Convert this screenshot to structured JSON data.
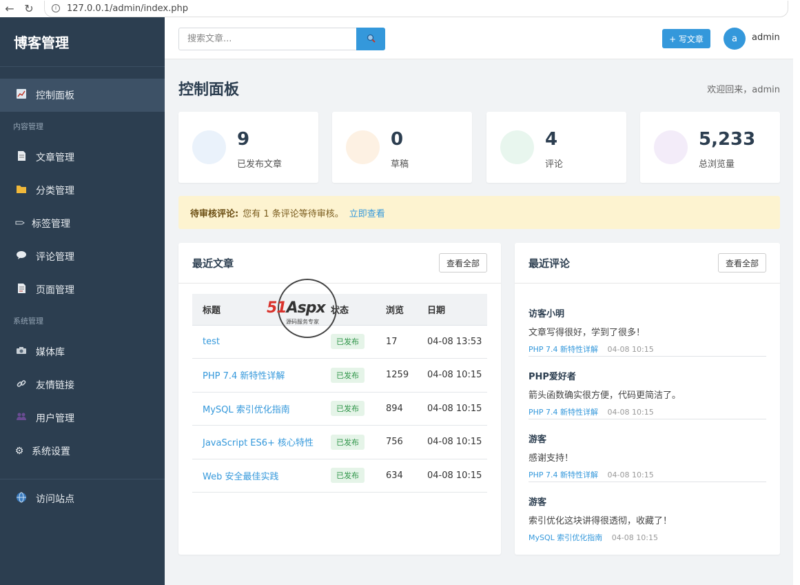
{
  "browser": {
    "url": "127.0.0.1/admin/index.php"
  },
  "sidebar": {
    "brand": "博客管理",
    "dashboard": {
      "label": "控制面板",
      "icon": "chart-icon"
    },
    "section_content": "内容管理",
    "content_items": [
      {
        "label": "文章管理",
        "icon": "document-icon"
      },
      {
        "label": "分类管理",
        "icon": "folder-icon"
      },
      {
        "label": "标签管理",
        "icon": "tag-icon"
      },
      {
        "label": "评论管理",
        "icon": "comment-icon"
      },
      {
        "label": "页面管理",
        "icon": "page-icon"
      }
    ],
    "section_system": "系统管理",
    "system_items": [
      {
        "label": "媒体库",
        "icon": "camera-icon"
      },
      {
        "label": "友情链接",
        "icon": "link-icon"
      },
      {
        "label": "用户管理",
        "icon": "users-icon"
      },
      {
        "label": "系统设置",
        "icon": "gear-icon"
      }
    ],
    "visit_site": {
      "label": "访问站点",
      "icon": "globe-icon"
    }
  },
  "header": {
    "search_placeholder": "搜索文章...",
    "write_button": "+ 写文章",
    "avatar_letter": "a",
    "username": "admin"
  },
  "page": {
    "title": "控制面板",
    "welcome": "欢迎回来，admin"
  },
  "stats": [
    {
      "value": "9",
      "label": "已发布文章",
      "color": "#eaf2fb"
    },
    {
      "value": "0",
      "label": "草稿",
      "color": "#fdf1e3"
    },
    {
      "value": "4",
      "label": "评论",
      "color": "#e8f6ee"
    },
    {
      "value": "5,233",
      "label": "总浏览量",
      "color": "#f3ecf9"
    }
  ],
  "alert": {
    "label": "待审核评论:",
    "message": "您有 1 条评论等待审核。",
    "link": "立即查看"
  },
  "recent_posts": {
    "title": "最近文章",
    "view_all": "查看全部",
    "columns": [
      "标题",
      "状态",
      "浏览",
      "日期"
    ],
    "rows": [
      {
        "title": "test",
        "status": "已发布",
        "views": "17",
        "date": "04-08 13:53"
      },
      {
        "title": "PHP 7.4 新特性详解",
        "status": "已发布",
        "views": "1259",
        "date": "04-08 10:15"
      },
      {
        "title": "MySQL 索引优化指南",
        "status": "已发布",
        "views": "894",
        "date": "04-08 10:15"
      },
      {
        "title": "JavaScript ES6+ 核心特性",
        "status": "已发布",
        "views": "756",
        "date": "04-08 10:15"
      },
      {
        "title": "Web 安全最佳实践",
        "status": "已发布",
        "views": "634",
        "date": "04-08 10:15"
      }
    ]
  },
  "recent_comments": {
    "title": "最近评论",
    "view_all": "查看全部",
    "items": [
      {
        "author": "访客小明",
        "text": "文章写得很好，学到了很多！",
        "post": "PHP 7.4 新特性详解",
        "time": "04-08 10:15"
      },
      {
        "author": "PHP爱好者",
        "text": "箭头函数确实很方便，代码更简洁了。",
        "post": "PHP 7.4 新特性详解",
        "time": "04-08 10:15"
      },
      {
        "author": "游客",
        "text": "感谢支持！",
        "post": "PHP 7.4 新特性详解",
        "time": "04-08 10:15"
      },
      {
        "author": "游客",
        "text": "索引优化这块讲得很透彻，收藏了！",
        "post": "MySQL 索引优化指南",
        "time": "04-08 10:15"
      }
    ]
  },
  "watermark": {
    "brand_red": "51",
    "brand_dark": "Aspx",
    "subtitle": "源码服务专家"
  }
}
